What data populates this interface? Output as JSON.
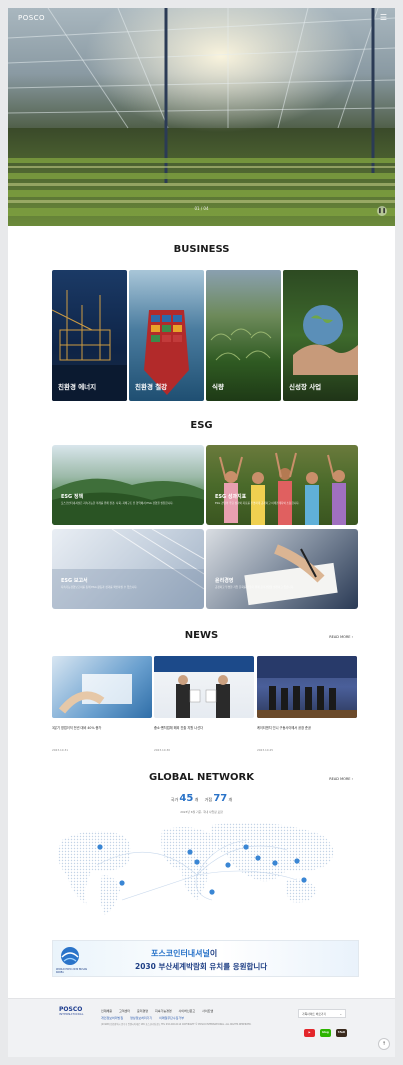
{
  "hero": {
    "logo": "POSCO",
    "menu_icon": "hamburger-icon",
    "caption": "01 / 04",
    "control_icon": "pause-icon"
  },
  "business": {
    "title": "BUSINESS",
    "items": [
      {
        "label": "친환경 에너지"
      },
      {
        "label": "친환경 철강"
      },
      {
        "label": "식량"
      },
      {
        "label": "신성장 사업"
      }
    ]
  },
  "esg": {
    "title": "ESG",
    "items": [
      {
        "title": "ESG 정책",
        "desc": "포스코인터내셔널은 지속가능한 미래를 위해 환경, 사회, 지배구조 전 영역에서 ESG 경영을 실천합니다."
      },
      {
        "title": "ESG 성과지표",
        "desc": "ESG 경영의 주요 성과와 지표를 투명하게 공개하고 이해관계자와 소통합니다."
      },
      {
        "title": "ESG 보고서",
        "desc": "지속가능경영보고서를 통해 ESG 활동과 성과를 확인하실 수 있습니다."
      },
      {
        "title": "윤리경영",
        "desc": "공정하고 투명한 기업 문화를 만들기 위해 윤리경영을 실천하고 있습니다."
      }
    ]
  },
  "news": {
    "title": "NEWS",
    "more": "READ MORE",
    "items": [
      {
        "title": "3분기 영업이익 전년 대비 40% 증가",
        "date": "2023.10.31"
      },
      {
        "title": "중소·벤처업체 해외 진출 지원 나선다",
        "date": "2023.10.30"
      },
      {
        "title": "케이티앤지 인니 구동사이에서 공장 준공",
        "date": "2023.10.25"
      }
    ]
  },
  "global": {
    "title": "GLOBAL NETWORK",
    "more": "READ MORE",
    "countries_label": "국가",
    "countries": "45",
    "bases_label": "거점",
    "bases": "77",
    "unit": "개",
    "note": "2023년 6월 기준, 국내 사업장 포함"
  },
  "banner": {
    "line1_highlight": "포스코인터내셔널",
    "line1_rest": "이",
    "line2": "2030 부산세계박람회 유치를 응원합니다",
    "logo_text": "WORLD EXPO 2030 BUSAN KOREA"
  },
  "footer": {
    "logo": "POSCO",
    "logo_sub": "INTERNATIONAL",
    "links": [
      "인재채용",
      "고객센터",
      "윤리경영",
      "지속가능경영",
      "사이버신문고",
      "사이트맵"
    ],
    "links2": [
      "개인정보처리방침",
      "영상정보처리기기",
      "이메일무단수집거부"
    ],
    "text": "(21998) 인천광역시 연수구 컨벤시아대로 165 포스코타워-송도  TEL 032-200-0114  COPYRIGHT © POSCO INTERNATIONAL. ALL RIGHTS RESERVED.",
    "select": "가족사이트 바로가기",
    "sns": [
      {
        "label": "▶",
        "color": "#e3262b"
      },
      {
        "label": "blog",
        "color": "#2db400"
      },
      {
        "label": "TALK",
        "color": "#3a2a1d"
      }
    ],
    "top_icon": "arrow-up-icon"
  }
}
